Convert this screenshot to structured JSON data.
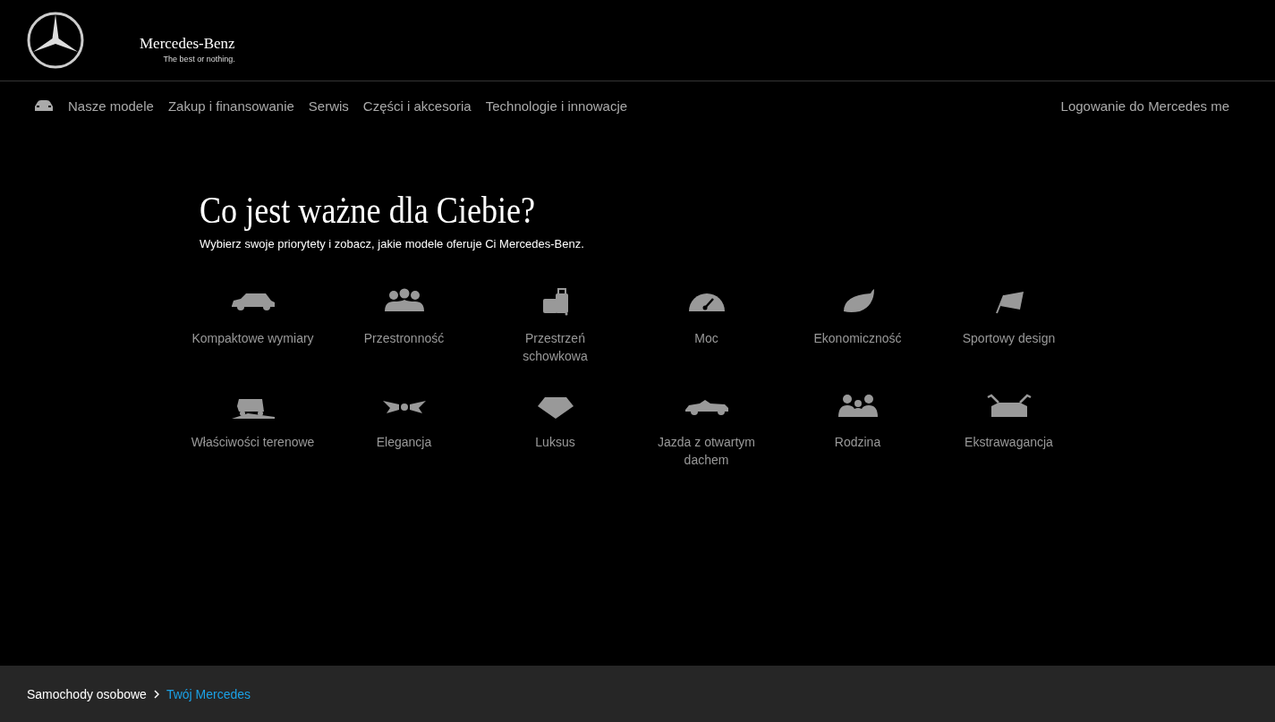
{
  "brand": {
    "name": "Mercedes-Benz",
    "slogan": "The best or nothing."
  },
  "nav": {
    "items": [
      {
        "label": "Nasze modele"
      },
      {
        "label": "Zakup i finansowanie"
      },
      {
        "label": "Serwis"
      },
      {
        "label": "Części i akcesoria"
      },
      {
        "label": "Technologie i innowacje"
      }
    ],
    "login": "Logowanie do Mercedes me"
  },
  "hero": {
    "title": "Co jest ważne dla Ciebie?",
    "subtitle": "Wybierz swoje priorytety i zobacz, jakie modele oferuje Ci Mercedes-Benz."
  },
  "priorities": [
    {
      "kind": "hatchback",
      "label": "Kompaktowe wymiary"
    },
    {
      "kind": "group",
      "label": "Przestronność"
    },
    {
      "kind": "luggage",
      "label": "Przestrzeń schowkowa"
    },
    {
      "kind": "gauge",
      "label": "Moc"
    },
    {
      "kind": "leaf",
      "label": "Ekonomiczność"
    },
    {
      "kind": "flag",
      "label": "Sportowy design"
    },
    {
      "kind": "offroad",
      "label": "Właściwości terenowe"
    },
    {
      "kind": "bowtie",
      "label": "Elegancja"
    },
    {
      "kind": "diamond",
      "label": "Luksus"
    },
    {
      "kind": "convertible",
      "label": "Jazda z otwartym dachem"
    },
    {
      "kind": "family",
      "label": "Rodzina"
    },
    {
      "kind": "gullwing",
      "label": "Ekstrawagancja"
    }
  ],
  "breadcrumb": [
    {
      "label": "Samochody osobowe",
      "current": false
    },
    {
      "label": "Twój Mercedes",
      "current": true
    }
  ]
}
